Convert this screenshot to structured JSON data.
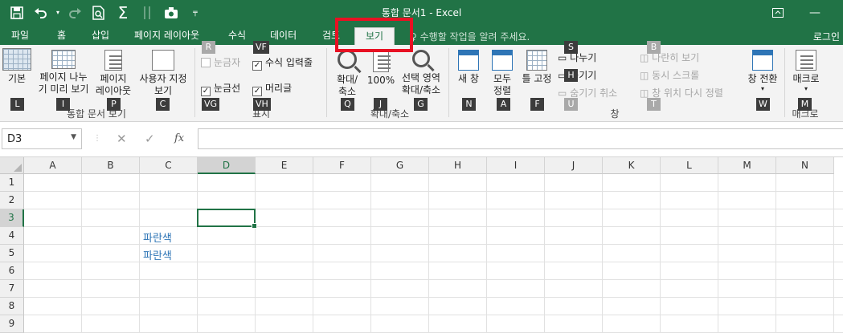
{
  "window": {
    "title": "통합 문서1 - Excel",
    "qat": {
      "save": "save-icon",
      "undo": "undo-icon",
      "redo": "redo-icon",
      "preview": "print-preview-icon",
      "sum": "autosum-icon",
      "sort": "sort-icon",
      "camera": "camera-icon",
      "customize": "qat-customize-icon"
    }
  },
  "tabs": [
    {
      "label": "파일"
    },
    {
      "label": "홈"
    },
    {
      "label": "삽입"
    },
    {
      "label": "페이지 레이아웃"
    },
    {
      "label": "수식"
    },
    {
      "label": "데이터"
    },
    {
      "label": "검토"
    },
    {
      "label": "보기"
    }
  ],
  "tellme": "수행할 작업을 알려 주세요.",
  "login": "로그인",
  "ribbon": {
    "workbook_views": {
      "normal": "기본",
      "page_break_1": "페이지 나누",
      "page_break_2": "기 미리 보기",
      "page_layout_1": "페이지",
      "page_layout_2": "레이아웃",
      "custom_1": "사용자 지정",
      "custom_2": "보기",
      "label": "통합 문서 보기"
    },
    "show": {
      "ruler": "눈금자",
      "formula_bar": "수식 입력줄",
      "gridlines": "눈금선",
      "headings": "머리글",
      "label": "표시"
    },
    "zoom": {
      "zoom_1": "확대/",
      "zoom_2": "축소",
      "hundred": "100%",
      "selection_1": "선택 영역",
      "selection_2": "확대/축소",
      "label": "확대/축소"
    },
    "window": {
      "new_window": "새 창",
      "arrange_1": "모두",
      "arrange_2": "정렬",
      "freeze": "틀 고정",
      "split": "나누기",
      "hide": "숨기기",
      "unhide": "숨기기 취소",
      "side_by_side": "나란히 보기",
      "sync_scroll": "동시 스크롤",
      "reset_pos": "창 위치 다시 정렬",
      "switch": "창 전환",
      "label": "창"
    },
    "macros": {
      "macro": "매크로",
      "label": "매크로"
    }
  },
  "keytips": {
    "L": "L",
    "I": "I",
    "P": "P",
    "C": "C",
    "R": "R",
    "VF": "VF",
    "VG": "VG",
    "VH": "VH",
    "Q": "Q",
    "J": "J",
    "G": "G",
    "N": "N",
    "A": "A",
    "F": "F",
    "S": "S",
    "H": "H",
    "U": "U",
    "B": "B",
    "T": "T",
    "W": "W",
    "M": "M"
  },
  "formula_bar": {
    "name_box": "D3",
    "cancel": "✕",
    "enter": "✓",
    "fx": "fx",
    "content": ""
  },
  "sheet": {
    "columns": [
      "A",
      "B",
      "C",
      "D",
      "E",
      "F",
      "G",
      "H",
      "I",
      "J",
      "K",
      "L",
      "M",
      "N"
    ],
    "rows": [
      "1",
      "2",
      "3",
      "4",
      "5",
      "6",
      "7",
      "8",
      "9"
    ],
    "selected_cell": "D3",
    "cells": [
      {
        "ref": "C4",
        "value": "파란색"
      },
      {
        "ref": "C5",
        "value": "파란색"
      }
    ]
  },
  "colors": {
    "accent": "#217346",
    "text_blue": "#2e75b6",
    "highlight": "#e81123"
  }
}
